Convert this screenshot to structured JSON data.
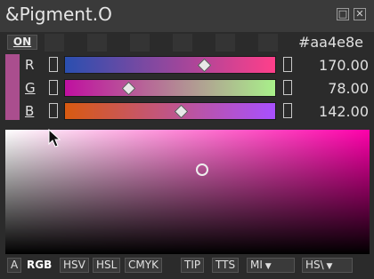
{
  "window": {
    "title": "&Pigment.O"
  },
  "header": {
    "on_label": "ON",
    "hex_value": "#aa4e8e"
  },
  "colors": {
    "current": "#aa4e8e",
    "hue": "#ff00aa",
    "r_gradient": [
      "#2a4fb0",
      "#ff3f8a"
    ],
    "g_gradient": [
      "#c010a0",
      "#a8f08a"
    ],
    "b_gradient": [
      "#d85a10",
      "#a850ff"
    ]
  },
  "channels": [
    {
      "label": "R",
      "value": "170.00",
      "level": 0.667
    },
    {
      "label": "G",
      "value": "78.00",
      "level": 0.306
    },
    {
      "label": "B",
      "value": "142.00",
      "level": 0.557
    }
  ],
  "bottom_bar": {
    "a": "A",
    "rgb": "RGB",
    "hsv": "HSV",
    "hsl": "HSL",
    "cmyk": "CMYK",
    "tip": "TIP",
    "tts": "TTS",
    "mode_select": "MI",
    "space_select": "HS\\"
  }
}
